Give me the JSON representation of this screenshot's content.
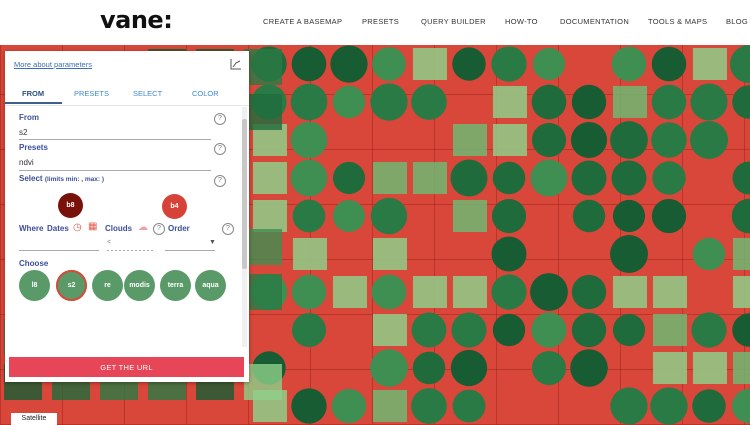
{
  "header": {
    "logo": "vane:",
    "nav": [
      "CREATE A BASEMAP",
      "PRESETS",
      "QUERY BUILDER",
      "HOW-TO",
      "DOCUMENTATION",
      "TOOLS & MAPS",
      "BLOG"
    ]
  },
  "panel": {
    "more_link": "More about parameters",
    "tabs": [
      "FROM",
      "PRESETS",
      "SELECT",
      "COLOR"
    ],
    "active_tab": "FROM",
    "from_label": "From",
    "from_value": "s2",
    "presets_label": "Presets",
    "presets_value": "ndvi",
    "select_label": "Select",
    "select_limits": "(limits min: , max: )",
    "bands": [
      {
        "label": "b8",
        "color": "#7a120c"
      },
      {
        "label": "b4",
        "color": "#d74238"
      }
    ],
    "where_label": "Where",
    "dates_label": "Dates",
    "clouds_label": "Clouds",
    "order_label": "Order",
    "dates_value": "<",
    "choose_label": "Choose",
    "satellites": [
      "l8",
      "s2",
      "re",
      "modis",
      "terra",
      "aqua"
    ],
    "selected_satellite": "s2",
    "get_url": "GET THE URL",
    "help_glyph": "?"
  },
  "map": {
    "layer_label": "Satellite"
  },
  "colors": {
    "accent": "#e74558",
    "label": "#3b4f9a",
    "tab": "#3d8ad1",
    "satellite_button": "#5a9a68",
    "map_red": "#d8473a",
    "map_green": "#1f6b3c"
  }
}
